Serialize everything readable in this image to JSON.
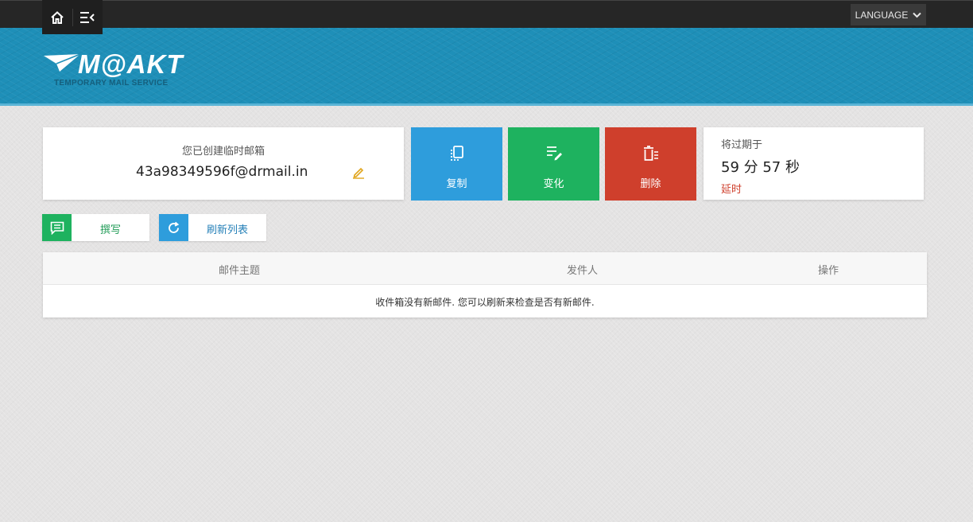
{
  "topbar": {
    "home_icon": "home-icon",
    "menu_icon": "menu-collapse-icon",
    "language_label": "LANGUAGE"
  },
  "header": {
    "logo_text": "M@AKT",
    "logo_subtitle": "TEMPORARY MAIL SERVICE",
    "brand_color": "#1e8fb8"
  },
  "mailbox": {
    "label": "您已创建临时邮箱",
    "address": "43a98349596f@drmail.in"
  },
  "actions": {
    "copy_label": "复制",
    "change_label": "变化",
    "delete_label": "删除",
    "copy_color": "#2e9ddc",
    "change_color": "#1eb25f",
    "delete_color": "#cf3f2c"
  },
  "timer": {
    "label": "将过期于",
    "value": "59 分 57 秒",
    "extend_label": "延时"
  },
  "toolbar": {
    "compose_label": "撰写",
    "refresh_label": "刷新列表"
  },
  "inbox": {
    "columns": [
      "邮件主题",
      "发件人",
      "操作"
    ],
    "empty_message": "收件箱没有新邮件. 您可以刷新来检查是否有新邮件."
  }
}
